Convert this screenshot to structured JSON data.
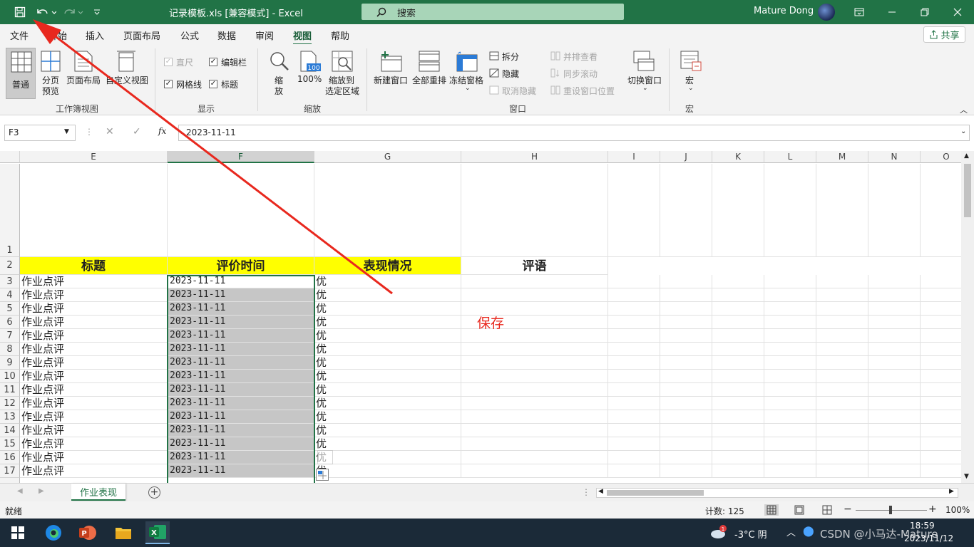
{
  "titlebar": {
    "doc_title": "记录模板.xls  [兼容模式]  -  Excel",
    "search_label": "搜索",
    "user_name": "Mature Dong"
  },
  "menu": {
    "tabs": [
      "文件",
      "开始",
      "插入",
      "页面布局",
      "公式",
      "数据",
      "审阅",
      "视图",
      "帮助"
    ],
    "active": "视图",
    "share": "共享"
  },
  "ribbon": {
    "workbook_views": {
      "group": "工作簿视图",
      "normal": "普通",
      "page_break_1": "分页",
      "page_break_2": "预览",
      "page_layout": "页面布局",
      "custom": "自定义视图"
    },
    "show": {
      "group": "显示",
      "ruler": "直尺",
      "formula_bar": "编辑栏",
      "gridlines": "网格线",
      "headings": "标题"
    },
    "zoom": {
      "group": "缩放",
      "zoom_1": "缩",
      "zoom_2": "放",
      "p100": "100%",
      "fit_1": "缩放到",
      "fit_2": "选定区域",
      "icon_100": "100"
    },
    "window": {
      "group": "窗口",
      "new_window": "新建窗口",
      "arrange_all": "全部重排",
      "freeze": "冻结窗格",
      "split": "拆分",
      "hide": "隐藏",
      "unhide": "取消隐藏",
      "side_by_side": "并排查看",
      "sync_scroll": "同步滚动",
      "reset_pos": "重设窗口位置",
      "switch": "切换窗口"
    },
    "macros": {
      "group": "宏",
      "macros": "宏"
    }
  },
  "formula_bar": {
    "name_box": "F3",
    "fx": "fx",
    "value": "2023-11-11"
  },
  "grid": {
    "columns": [
      "E",
      "F",
      "G",
      "H",
      "I",
      "J",
      "K",
      "L",
      "M",
      "N",
      "O"
    ],
    "selected_column": "F",
    "header_row": {
      "row": "2",
      "cells": [
        "标题",
        "评价时间",
        "表现情况",
        "评语"
      ]
    },
    "rows": [
      {
        "n": "3",
        "e": "作业点评",
        "f": "2023-11-11",
        "g": "优"
      },
      {
        "n": "4",
        "e": "作业点评",
        "f": "2023-11-11",
        "g": "优"
      },
      {
        "n": "5",
        "e": "作业点评",
        "f": "2023-11-11",
        "g": "优"
      },
      {
        "n": "6",
        "e": "作业点评",
        "f": "2023-11-11",
        "g": "优"
      },
      {
        "n": "7",
        "e": "作业点评",
        "f": "2023-11-11",
        "g": "优"
      },
      {
        "n": "8",
        "e": "作业点评",
        "f": "2023-11-11",
        "g": "优"
      },
      {
        "n": "9",
        "e": "作业点评",
        "f": "2023-11-11",
        "g": "优"
      },
      {
        "n": "10",
        "e": "作业点评",
        "f": "2023-11-11",
        "g": "优"
      },
      {
        "n": "11",
        "e": "作业点评",
        "f": "2023-11-11",
        "g": "优"
      },
      {
        "n": "12",
        "e": "作业点评",
        "f": "2023-11-11",
        "g": "优"
      },
      {
        "n": "13",
        "e": "作业点评",
        "f": "2023-11-11",
        "g": "优"
      },
      {
        "n": "14",
        "e": "作业点评",
        "f": "2023-11-11",
        "g": "优"
      },
      {
        "n": "15",
        "e": "作业点评",
        "f": "2023-11-11",
        "g": "优"
      },
      {
        "n": "16",
        "e": "作业点评",
        "f": "2023-11-11",
        "g": "优"
      },
      {
        "n": "17",
        "e": "作业点评",
        "f": "2023-11-11",
        "g": "优"
      }
    ],
    "row1": "1"
  },
  "annotation": {
    "text": "保存",
    "color": "#e8281e"
  },
  "sheets": {
    "active": "作业表现"
  },
  "status": {
    "ready": "就绪",
    "count": "计数: 125",
    "zoom": "100%"
  },
  "taskbar": {
    "weather": "-3°C  阴",
    "time": "18:59",
    "date": "2023/11/12",
    "watermark": "CSDN @小马达-Mature"
  },
  "colors": {
    "excel_green": "#217346",
    "header_yellow": "#ffff00",
    "selection_fill": "#c6c6c6"
  }
}
